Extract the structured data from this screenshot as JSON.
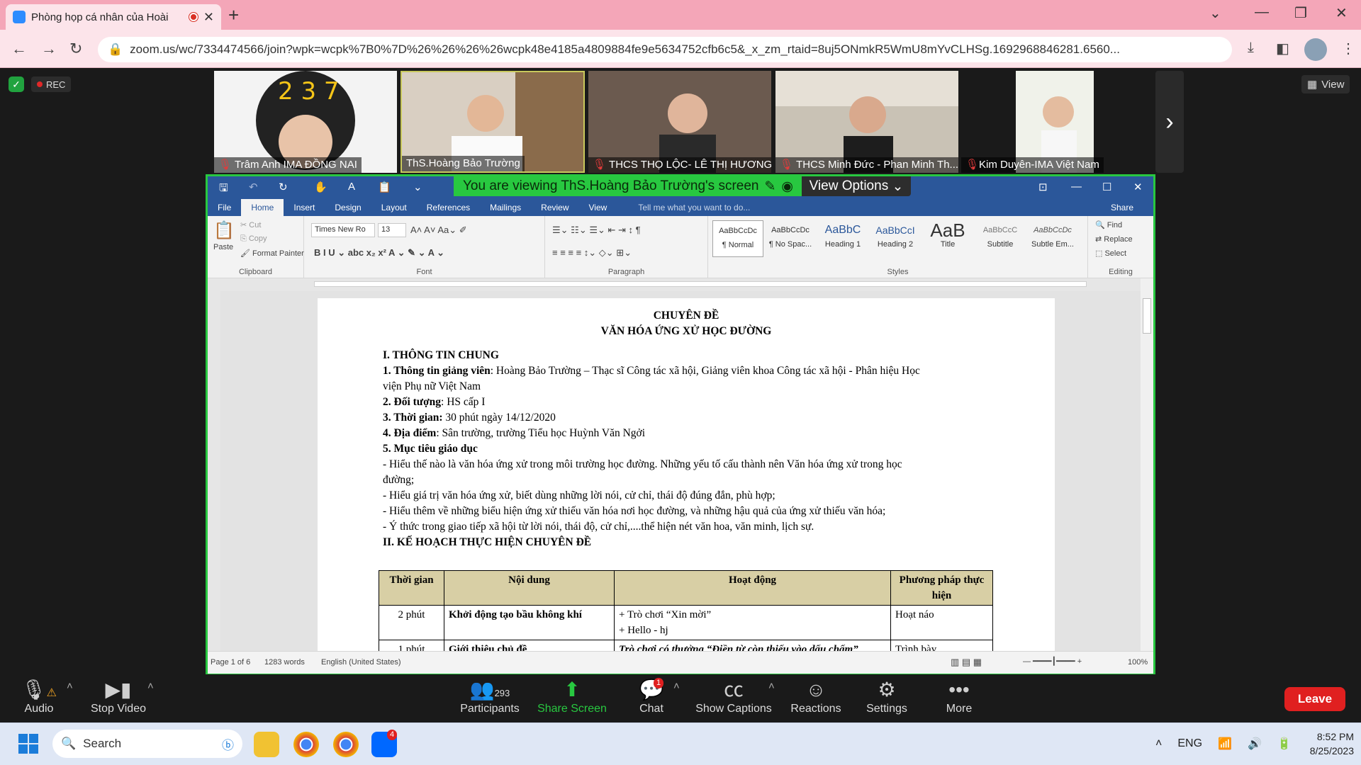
{
  "browser": {
    "tab_title": "Phòng họp cá nhân của Hoài",
    "url": "zoom.us/wc/7334474566/join?wpk=wcpk%7B0%7D%26%26%26%26wcpk48e4185a4809884fe9e5634752cfb6c5&_x_zm_rtaid=8uj5ONmkR5WmU8mYvCLHSg.1692968846281.6560..."
  },
  "zoom": {
    "rec": "REC",
    "view": "View",
    "participants": [
      {
        "name": "Trâm Anh IMA ĐỒNG NAI"
      },
      {
        "name": "ThS.Hoàng Bảo Trường"
      },
      {
        "name": "THCS THỌ LỘC- LÊ THỊ HƯƠNG..."
      },
      {
        "name": "THCS Minh Đức - Phan Minh Th..."
      },
      {
        "name": "Kim Duyên-IMA Việt Nam"
      }
    ],
    "viewing": "You are viewing ThS.Hoàng Bảo Trường's screen",
    "view_options": "View Options",
    "controls": {
      "audio": "Audio",
      "video": "Stop Video",
      "participants": "Participants",
      "participants_count": "293",
      "share": "Share Screen",
      "chat": "Chat",
      "chat_badge": "1",
      "captions": "Show Captions",
      "reactions": "Reactions",
      "settings": "Settings",
      "more": "More",
      "leave": "Leave"
    }
  },
  "word": {
    "tabs": [
      "File",
      "Home",
      "Insert",
      "Design",
      "Layout",
      "References",
      "Mailings",
      "Review",
      "View"
    ],
    "tell": "Tell me what you want to do...",
    "share": "Share",
    "clipboard": {
      "paste": "Paste",
      "cut": "Cut",
      "copy": "Copy",
      "painter": "Format Painter",
      "label": "Clipboard"
    },
    "font": {
      "name": "Times New Ro",
      "size": "13",
      "label": "Font"
    },
    "paragraph_label": "Paragraph",
    "styles": [
      {
        "sample": "AaBbCcDc",
        "name": "¶ Normal"
      },
      {
        "sample": "AaBbCcDc",
        "name": "¶ No Spac..."
      },
      {
        "sample": "AaBbC",
        "name": "Heading 1"
      },
      {
        "sample": "AaBbCcI",
        "name": "Heading 2"
      },
      {
        "sample": "AaB",
        "name": "Title"
      },
      {
        "sample": "AaBbCcC",
        "name": "Subtitle"
      },
      {
        "sample": "AaBbCcDc",
        "name": "Subtle Em..."
      }
    ],
    "styles_label": "Styles",
    "editing": {
      "find": "Find",
      "replace": "Replace",
      "select": "Select",
      "label": "Editing"
    },
    "status": {
      "page": "Page 1 of 6",
      "words": "1283 words",
      "lang": "English (United States)",
      "zoom": "100%"
    }
  },
  "doc": {
    "title1": "CHUYÊN ĐỀ",
    "title2": "VĂN HÓA ỨNG XỬ HỌC ĐƯỜNG",
    "h1": "I. THÔNG TIN CHUNG",
    "l1b": "1. Thông tin giảng viên",
    "l1": ": Hoàng Bảo Trường – Thạc sĩ Công tác xã hội, Giảng viên khoa Công tác xã hội -  Phân hiệu Học",
    "l1c": "viện Phụ nữ Việt Nam",
    "l2b": "2. Đối tượng",
    "l2": ": HS cấp I",
    "l3b": "3. Thời gian:",
    "l3": " 30 phút ngày 14/12/2020",
    "l4b": "4. Địa điểm",
    "l4": ": Sân trường, trường Tiểu học Huỳnh Văn Ngởi",
    "l5b": "5. Mục tiêu giáo dục",
    "m1": "- Hiểu thế nào là văn hóa ứng xử trong môi trường học đường. Những yếu tố cấu thành nên Văn hóa ứng xử trong học",
    "m1c": "đường;",
    "m2": "- Hiểu giá trị văn hóa ứng xử, biết dùng những lời nói, cử chỉ, thái độ đúng đắn, phù hợp;",
    "m3": "- Hiểu thêm về những biểu hiện ứng xử thiếu văn hóa nơi học đường, và những hậu quả của ứng xử thiếu văn hóa;",
    "m4": "- Ý thức trong giao tiếp xã hội từ lời nói, thái độ, cử chỉ,....thể hiện nét văn hoa, văn minh, lịch sự.",
    "h2": "II. KẾ HOẠCH THỰC HIỆN CHUYÊN ĐỀ",
    "table": {
      "headers": [
        "Thời gian",
        "Nội dung",
        "Hoạt động",
        "Phương pháp thực hiện"
      ],
      "rows": [
        [
          "2 phút",
          "Khởi động tạo bầu không khí",
          "+ Trò chơi “Xin mời”",
          "+ Hello - hj",
          "Hoạt náo"
        ],
        [
          "1 phút",
          "Giới thiệu chủ đề",
          "Trò chơi có thưởng “Điền từ còn thiếu vào dấu chấm”",
          "",
          "Trình bày"
        ]
      ]
    }
  },
  "taskbar": {
    "search": "Search",
    "lang": "ENG",
    "time": "8:52 PM",
    "date": "8/25/2023",
    "zalo_badge": "4"
  }
}
